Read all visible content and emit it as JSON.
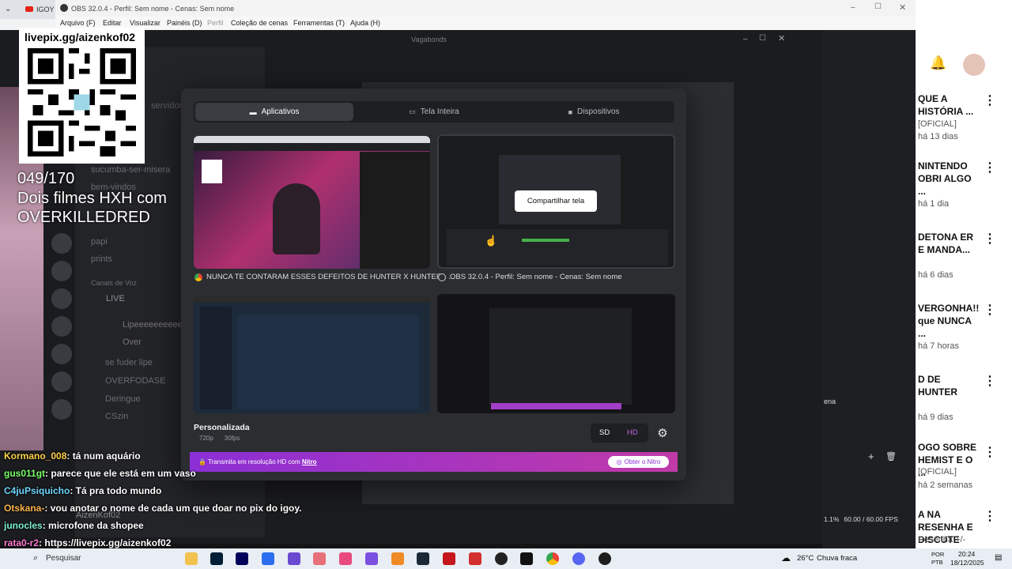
{
  "browser": {
    "tab_title": "IGOY R"
  },
  "obs": {
    "title": "OBS 32.0.4 - Perfil: Sem nome - Cenas: Sem nome",
    "menu": [
      "Arquivo (F)",
      "Editar",
      "Visualizar",
      "Painéis (D)",
      "Perfil",
      "Coleção de cenas",
      "Ferramentas (T)",
      "Ajuda (H)"
    ]
  },
  "discord": {
    "window_title": "Vagabonds",
    "channels": [
      "sucumba-ser-misera",
      "bem-vindos",
      "papi",
      "prints"
    ],
    "voice_section": "Canais de Voz",
    "voice_live": "LIVE",
    "voice_users": [
      "Lipeeeeeeeeeee",
      "Over"
    ],
    "voice_other": [
      "se fuder lipe",
      "OVERFODASE",
      "Deringue",
      "CSzin"
    ],
    "servidor_hint": "servidor",
    "user": "AizenKof02"
  },
  "share_modal": {
    "tabs": [
      {
        "label": "Aplicativos",
        "icon": "apps-icon"
      },
      {
        "label": "Tela Inteira",
        "icon": "monitor-icon"
      },
      {
        "label": "Dispositivos",
        "icon": "camera-icon"
      }
    ],
    "sources": [
      {
        "caption": "NUNCA TE CONTARAM ESSES DEFEITOS DE HUNTER X HUNTER - ...",
        "icon": "chrome-icon"
      },
      {
        "caption": "OBS 32.0.4 - Perfil: Sem nome - Cenas: Sem nome",
        "icon": "obs-icon"
      }
    ],
    "share_button": "Compartilhar tela",
    "quality_label": "Personalizada",
    "resolution": "720p",
    "fps": "30fps",
    "sd": "SD",
    "hd": "HD",
    "nitro_text": "Transmita em resolução HD com",
    "nitro_link": "Nitro",
    "nitro_button": "Obter o Nitro"
  },
  "overlay": {
    "qr_url": "livepix.gg/aizenkof02",
    "goal_count": "049/170",
    "goal_lines": [
      "Dois filmes HXH com",
      "OVERKILLEDRED"
    ]
  },
  "chat": [
    {
      "user": "Kormano_008",
      "msg": ": tá num aquário",
      "color": "#ffd24a"
    },
    {
      "user": "gus011gt",
      "msg": ": parece que ele está em um vaso",
      "color": "#7bff6a"
    },
    {
      "user": "C4juPsiquicho",
      "msg": ": Tá pra todo mundo",
      "color": "#6fd6ff"
    },
    {
      "user": "Otskana-",
      "msg": ": vou anotar o nome de cada um que doar no pix do igoy.",
      "color": "#ffb74a"
    },
    {
      "user": "junocles",
      "msg": ": microfone da shopee",
      "color": "#7ff0d0"
    },
    {
      "user": "rata0-r2",
      "msg": ": https://livepix.gg/aizenkof02",
      "color": "#ff7ad0"
    }
  ],
  "youtube": {
    "items": [
      {
        "title": "QUE A HISTÓRIA ...",
        "channel": "[OFICIAL]",
        "age": "há 13 dias"
      },
      {
        "title": "NINTENDO OBRI ALGO ...",
        "channel": "",
        "age": "há 1 dia"
      },
      {
        "title": "DETONA ER E MANDA...",
        "channel": "",
        "age": "há 6 dias"
      },
      {
        "title": "VERGONHA!! que NUNCA ...",
        "channel": "",
        "age": "há 7 horas"
      },
      {
        "title": "D DE HUNTER",
        "channel": "",
        "age": "há 9 dias"
      },
      {
        "title": "OGO SOBRE HEMIST E O ...",
        "channel": "[OFICIAL]",
        "age": "há 2 semanas"
      },
      {
        "title": "A NA RESENHA E DISCUTE COM O ...",
        "channel": "Resenha +/-",
        "age": ""
      }
    ]
  },
  "obs_status": {
    "cpu": "1.1%",
    "fps": "60.00 / 60.00 FPS",
    "scenes_label": "ena"
  },
  "taskbar": {
    "search": "Pesquisar",
    "weather_temp": "26°C",
    "weather_desc": "Chuva fraca",
    "lang1": "POR",
    "lang2": "PTB",
    "time": "20:24",
    "date": "18/12/2025"
  }
}
